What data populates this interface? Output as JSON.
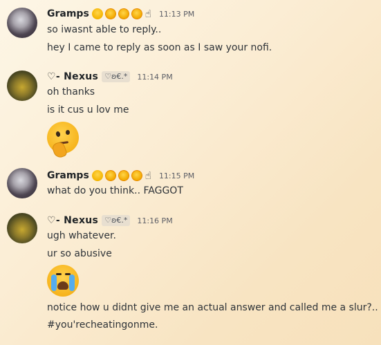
{
  "messages": [
    {
      "user": "Gramps",
      "timestamp": "11:13 PM",
      "lines": [
        "so iwasnt able to reply..",
        "hey I came to reply as soon as I saw your nofi."
      ]
    },
    {
      "user": "♡- 𝗡𝗲𝘅𝘂𝘀",
      "tag": "♡ʚ€.*",
      "timestamp": "11:14 PM",
      "lines": [
        "oh thanks",
        "is it cus u lov me"
      ],
      "emoji": "thinking-face"
    },
    {
      "user": "Gramps",
      "timestamp": "11:15 PM",
      "lines": [
        "what do you think.. FAGGOT"
      ]
    },
    {
      "user": "♡- 𝗡𝗲𝘅𝘂𝘀",
      "tag": "♡ʚ€.*",
      "timestamp": "11:16 PM",
      "lines": [
        "ugh whatever.",
        "ur so abusive"
      ],
      "emoji": "loudly-crying-face",
      "after_lines": [
        "notice how u didnt give me an actual answer and called me a slur?..",
        "#you'recheatingonme."
      ]
    }
  ],
  "gramps_badges": [
    "laughing-emoji",
    "rofl-emoji",
    "rofl-emoji",
    "rofl-emoji",
    "pointing-finger-emoji"
  ],
  "finger_glyph": "☝"
}
